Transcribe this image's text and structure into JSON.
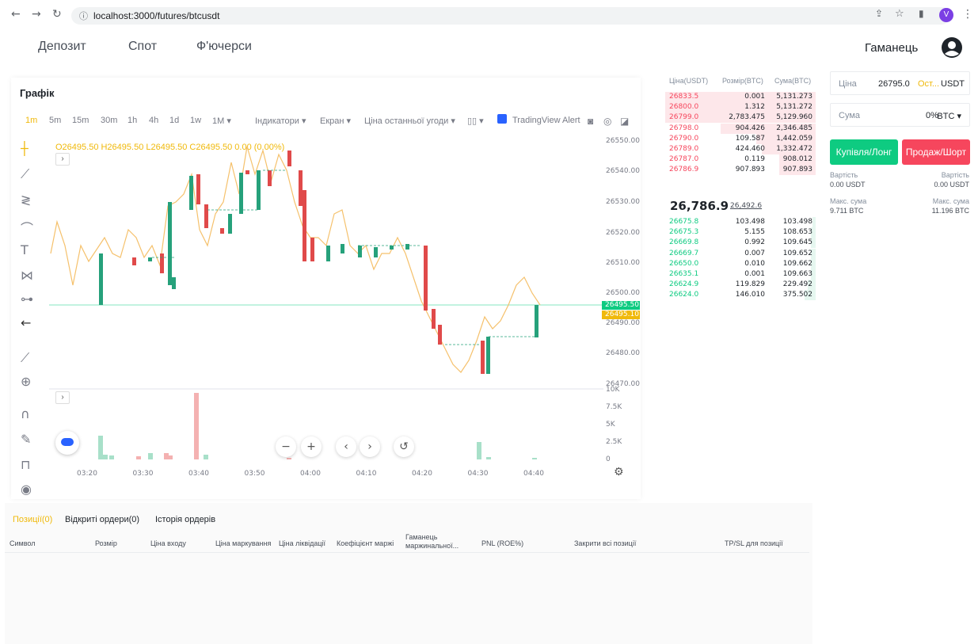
{
  "browser": {
    "url": "localhost:3000/futures/btcusdt",
    "profile_initial": "V"
  },
  "nav": {
    "deposit": "Депозит",
    "spot": "Спот",
    "futures": "Ф'ючерси",
    "wallet": "Гаманець"
  },
  "chart": {
    "title": "Графік",
    "timeframes": [
      "1m",
      "5m",
      "15m",
      "30m",
      "1h",
      "4h",
      "1d",
      "1w",
      "1M ▾"
    ],
    "active_timeframe": "1m",
    "indicators": "Індикатори ▾",
    "screen": "Екран ▾",
    "last_price_menu": "Ціна останньої угоди ▾",
    "alert": "TradingView Alert",
    "ohlc": "O26495.50  H26495.50  L26495.50  C26495.50  0.00 (0.00%)",
    "last_tag": "26495.50",
    "mark_tag": "26495.10",
    "price_axis": [
      "26550.00",
      "26540.00",
      "26530.00",
      "26520.00",
      "26510.00",
      "26500.00",
      "26490.00",
      "26480.00",
      "26470.00"
    ],
    "volume_axis": [
      "10K",
      "7.5K",
      "5K",
      "2.5K",
      "0"
    ],
    "time_axis": [
      "03:20",
      "03:30",
      "03:40",
      "03:50",
      "04:00",
      "04:10",
      "04:20",
      "04:30",
      "04:40"
    ]
  },
  "orderbook": {
    "headers": [
      "Ціна(USDT)",
      "Розмір(BTC)",
      "Сума(BTC)"
    ],
    "asks": [
      [
        "26833.5",
        "0.001",
        "5,131.273"
      ],
      [
        "26800.0",
        "1.312",
        "5,131.272"
      ],
      [
        "26799.0",
        "2,783.475",
        "5,129.960"
      ],
      [
        "26798.0",
        "904.426",
        "2,346.485"
      ],
      [
        "26790.0",
        "109.587",
        "1,442.059"
      ],
      [
        "26789.0",
        "424.460",
        "1,332.472"
      ],
      [
        "26787.0",
        "0.119",
        "908.012"
      ],
      [
        "26786.9",
        "907.893",
        "907.893"
      ]
    ],
    "last_price": "26,786.9",
    "mark_price": "26,492.6",
    "bids": [
      [
        "26675.8",
        "103.498",
        "103.498"
      ],
      [
        "26675.3",
        "5.155",
        "108.653"
      ],
      [
        "26669.8",
        "0.992",
        "109.645"
      ],
      [
        "26669.7",
        "0.007",
        "109.652"
      ],
      [
        "26650.0",
        "0.010",
        "109.662"
      ],
      [
        "26635.1",
        "0.001",
        "109.663"
      ],
      [
        "26624.9",
        "119.829",
        "229.492"
      ],
      [
        "26624.0",
        "146.010",
        "375.502"
      ]
    ]
  },
  "trade": {
    "price_label": "Ціна",
    "price_value": "26795.0",
    "price_type": "Ост...",
    "price_unit": "USDT",
    "amount_label": "Сума",
    "amount_value": "0%",
    "amount_unit": "BTC ▾",
    "buy": "Купівля/Лонг",
    "sell": "Продаж/Шорт",
    "cost_label": "Вартість",
    "buy_cost": "0.00 USDT",
    "sell_cost": "0.00 USDT",
    "max_label": "Макс. сума",
    "buy_max": "9.711 BTC",
    "sell_max": "11.196 BTC",
    "buy_color": "#0ecb81",
    "sell_color": "#f6465d"
  },
  "positions": {
    "tabs": [
      "Позиції(0)",
      "Відкриті ордери(0)",
      "Історія ордерів"
    ],
    "columns": [
      "Символ",
      "Розмір",
      "Ціна входу",
      "Ціна маркування",
      "Ціна ліквідації",
      "Коефіцієнт маржі",
      "Гаманець маржинальної...",
      "PNL (ROE%)",
      "Закрити всі позиції",
      "TP/SL для позиції"
    ]
  }
}
